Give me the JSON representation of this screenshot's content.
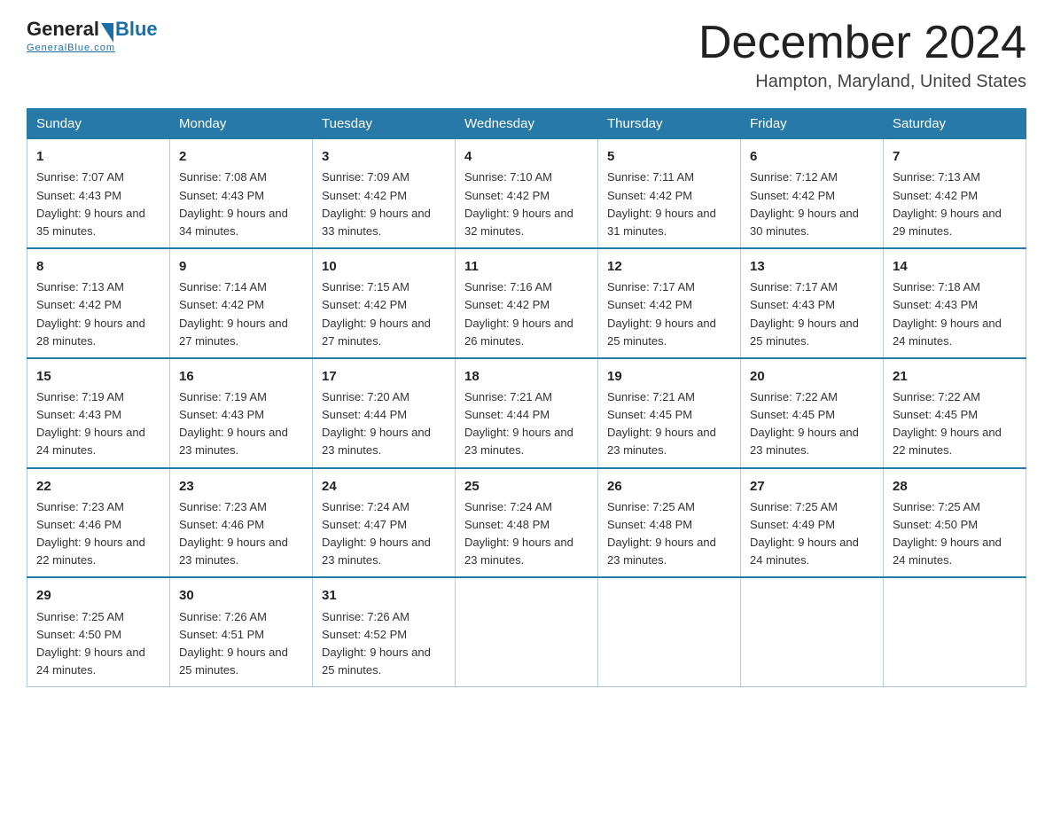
{
  "logo": {
    "general": "General",
    "blue": "Blue",
    "underline": "GeneralBlue.com"
  },
  "title": "December 2024",
  "location": "Hampton, Maryland, United States",
  "days_of_week": [
    "Sunday",
    "Monday",
    "Tuesday",
    "Wednesday",
    "Thursday",
    "Friday",
    "Saturday"
  ],
  "weeks": [
    [
      {
        "day": "1",
        "sunrise": "Sunrise: 7:07 AM",
        "sunset": "Sunset: 4:43 PM",
        "daylight": "Daylight: 9 hours and 35 minutes."
      },
      {
        "day": "2",
        "sunrise": "Sunrise: 7:08 AM",
        "sunset": "Sunset: 4:43 PM",
        "daylight": "Daylight: 9 hours and 34 minutes."
      },
      {
        "day": "3",
        "sunrise": "Sunrise: 7:09 AM",
        "sunset": "Sunset: 4:42 PM",
        "daylight": "Daylight: 9 hours and 33 minutes."
      },
      {
        "day": "4",
        "sunrise": "Sunrise: 7:10 AM",
        "sunset": "Sunset: 4:42 PM",
        "daylight": "Daylight: 9 hours and 32 minutes."
      },
      {
        "day": "5",
        "sunrise": "Sunrise: 7:11 AM",
        "sunset": "Sunset: 4:42 PM",
        "daylight": "Daylight: 9 hours and 31 minutes."
      },
      {
        "day": "6",
        "sunrise": "Sunrise: 7:12 AM",
        "sunset": "Sunset: 4:42 PM",
        "daylight": "Daylight: 9 hours and 30 minutes."
      },
      {
        "day": "7",
        "sunrise": "Sunrise: 7:13 AM",
        "sunset": "Sunset: 4:42 PM",
        "daylight": "Daylight: 9 hours and 29 minutes."
      }
    ],
    [
      {
        "day": "8",
        "sunrise": "Sunrise: 7:13 AM",
        "sunset": "Sunset: 4:42 PM",
        "daylight": "Daylight: 9 hours and 28 minutes."
      },
      {
        "day": "9",
        "sunrise": "Sunrise: 7:14 AM",
        "sunset": "Sunset: 4:42 PM",
        "daylight": "Daylight: 9 hours and 27 minutes."
      },
      {
        "day": "10",
        "sunrise": "Sunrise: 7:15 AM",
        "sunset": "Sunset: 4:42 PM",
        "daylight": "Daylight: 9 hours and 27 minutes."
      },
      {
        "day": "11",
        "sunrise": "Sunrise: 7:16 AM",
        "sunset": "Sunset: 4:42 PM",
        "daylight": "Daylight: 9 hours and 26 minutes."
      },
      {
        "day": "12",
        "sunrise": "Sunrise: 7:17 AM",
        "sunset": "Sunset: 4:42 PM",
        "daylight": "Daylight: 9 hours and 25 minutes."
      },
      {
        "day": "13",
        "sunrise": "Sunrise: 7:17 AM",
        "sunset": "Sunset: 4:43 PM",
        "daylight": "Daylight: 9 hours and 25 minutes."
      },
      {
        "day": "14",
        "sunrise": "Sunrise: 7:18 AM",
        "sunset": "Sunset: 4:43 PM",
        "daylight": "Daylight: 9 hours and 24 minutes."
      }
    ],
    [
      {
        "day": "15",
        "sunrise": "Sunrise: 7:19 AM",
        "sunset": "Sunset: 4:43 PM",
        "daylight": "Daylight: 9 hours and 24 minutes."
      },
      {
        "day": "16",
        "sunrise": "Sunrise: 7:19 AM",
        "sunset": "Sunset: 4:43 PM",
        "daylight": "Daylight: 9 hours and 23 minutes."
      },
      {
        "day": "17",
        "sunrise": "Sunrise: 7:20 AM",
        "sunset": "Sunset: 4:44 PM",
        "daylight": "Daylight: 9 hours and 23 minutes."
      },
      {
        "day": "18",
        "sunrise": "Sunrise: 7:21 AM",
        "sunset": "Sunset: 4:44 PM",
        "daylight": "Daylight: 9 hours and 23 minutes."
      },
      {
        "day": "19",
        "sunrise": "Sunrise: 7:21 AM",
        "sunset": "Sunset: 4:45 PM",
        "daylight": "Daylight: 9 hours and 23 minutes."
      },
      {
        "day": "20",
        "sunrise": "Sunrise: 7:22 AM",
        "sunset": "Sunset: 4:45 PM",
        "daylight": "Daylight: 9 hours and 23 minutes."
      },
      {
        "day": "21",
        "sunrise": "Sunrise: 7:22 AM",
        "sunset": "Sunset: 4:45 PM",
        "daylight": "Daylight: 9 hours and 22 minutes."
      }
    ],
    [
      {
        "day": "22",
        "sunrise": "Sunrise: 7:23 AM",
        "sunset": "Sunset: 4:46 PM",
        "daylight": "Daylight: 9 hours and 22 minutes."
      },
      {
        "day": "23",
        "sunrise": "Sunrise: 7:23 AM",
        "sunset": "Sunset: 4:46 PM",
        "daylight": "Daylight: 9 hours and 23 minutes."
      },
      {
        "day": "24",
        "sunrise": "Sunrise: 7:24 AM",
        "sunset": "Sunset: 4:47 PM",
        "daylight": "Daylight: 9 hours and 23 minutes."
      },
      {
        "day": "25",
        "sunrise": "Sunrise: 7:24 AM",
        "sunset": "Sunset: 4:48 PM",
        "daylight": "Daylight: 9 hours and 23 minutes."
      },
      {
        "day": "26",
        "sunrise": "Sunrise: 7:25 AM",
        "sunset": "Sunset: 4:48 PM",
        "daylight": "Daylight: 9 hours and 23 minutes."
      },
      {
        "day": "27",
        "sunrise": "Sunrise: 7:25 AM",
        "sunset": "Sunset: 4:49 PM",
        "daylight": "Daylight: 9 hours and 24 minutes."
      },
      {
        "day": "28",
        "sunrise": "Sunrise: 7:25 AM",
        "sunset": "Sunset: 4:50 PM",
        "daylight": "Daylight: 9 hours and 24 minutes."
      }
    ],
    [
      {
        "day": "29",
        "sunrise": "Sunrise: 7:25 AM",
        "sunset": "Sunset: 4:50 PM",
        "daylight": "Daylight: 9 hours and 24 minutes."
      },
      {
        "day": "30",
        "sunrise": "Sunrise: 7:26 AM",
        "sunset": "Sunset: 4:51 PM",
        "daylight": "Daylight: 9 hours and 25 minutes."
      },
      {
        "day": "31",
        "sunrise": "Sunrise: 7:26 AM",
        "sunset": "Sunset: 4:52 PM",
        "daylight": "Daylight: 9 hours and 25 minutes."
      },
      null,
      null,
      null,
      null
    ]
  ]
}
